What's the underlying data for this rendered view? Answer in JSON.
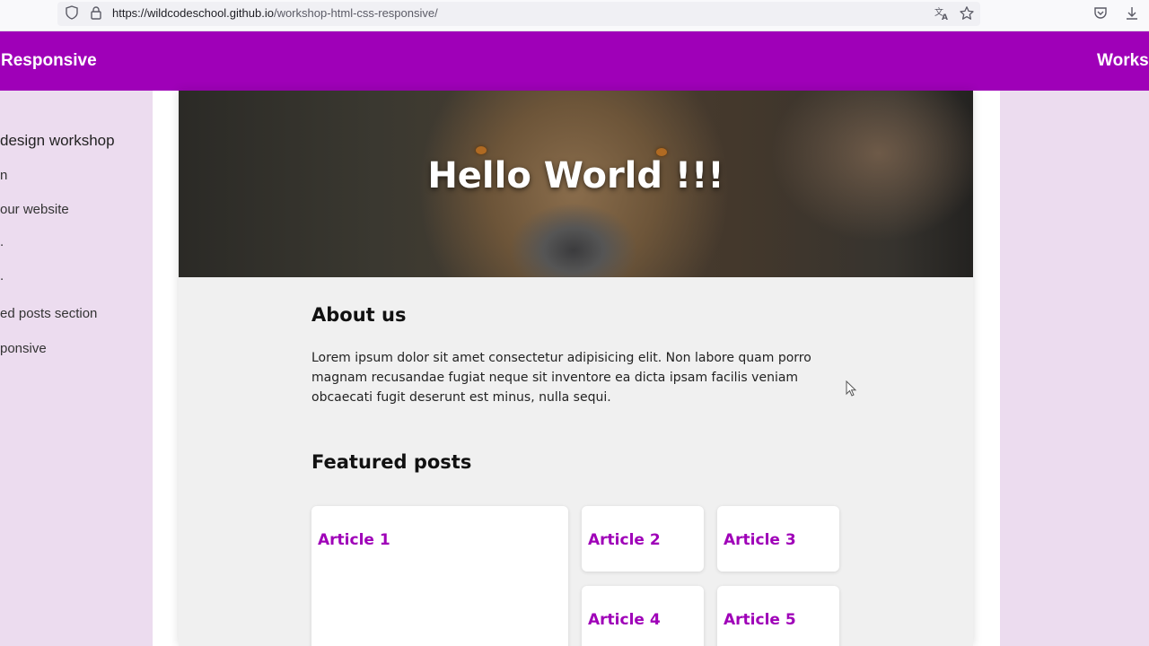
{
  "browser": {
    "url_host": "https://wildcodeschool.github.io",
    "url_path": "/workshop-html-css-responsive/",
    "icons": [
      "shield-icon",
      "lock-icon",
      "translate-icon",
      "bookmark-star-icon",
      "pocket-icon",
      "download-icon"
    ]
  },
  "header": {
    "brand": "Responsive",
    "right_link": "Worksh"
  },
  "sidebar": {
    "items": [
      {
        "label": "design workshop"
      },
      {
        "label": "n"
      },
      {
        "label": "our website"
      },
      {
        "label": "."
      },
      {
        "label": "."
      },
      {
        "label": "ed posts section"
      },
      {
        "label": "ponsive"
      }
    ]
  },
  "page": {
    "hero_title": "Hello World !!!",
    "about_heading": "About us",
    "about_text": "Lorem ipsum dolor sit amet consectetur adipisicing elit. Non labore quam porro magnam recusandae fugiat neque sit inventore ea dicta ipsam facilis veniam obcaecati fugit deserunt est minus, nulla sequi.",
    "featured_heading": "Featured posts",
    "articles": [
      {
        "title": "Article 1"
      },
      {
        "title": "Article 2"
      },
      {
        "title": "Article 3"
      },
      {
        "title": "Article 4"
      },
      {
        "title": "Article 5"
      }
    ]
  },
  "colors": {
    "accent": "#9f00b8",
    "background": "#ecdcef",
    "page_bg": "#f0f0f0"
  }
}
